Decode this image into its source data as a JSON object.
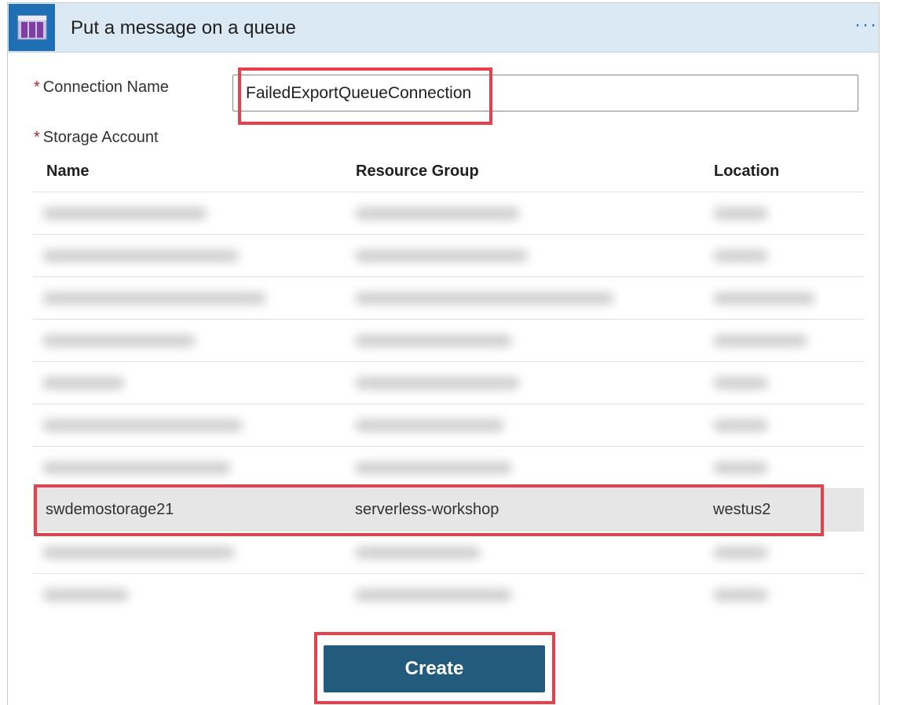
{
  "header": {
    "title": "Put a message on a queue",
    "more_label": "···",
    "icon": "storage-queue-icon"
  },
  "connection": {
    "required_mark": "*",
    "label": "Connection Name",
    "value": "FailedExportQueueConnection"
  },
  "storage": {
    "required_mark": "*",
    "label": "Storage Account",
    "columns": [
      "Name",
      "Resource Group",
      "Location"
    ],
    "selected_row": {
      "name": "swdemostorage21",
      "resource_group": "serverless-workshop",
      "location": "westus2"
    }
  },
  "actions": {
    "create_label": "Create"
  },
  "colors": {
    "header_bg": "#dbe9f5",
    "accent": "#1f6fb5",
    "button_bg": "#225b7c",
    "highlight_box": "#e8404a",
    "selected_row_bg": "#e6e6e6"
  }
}
